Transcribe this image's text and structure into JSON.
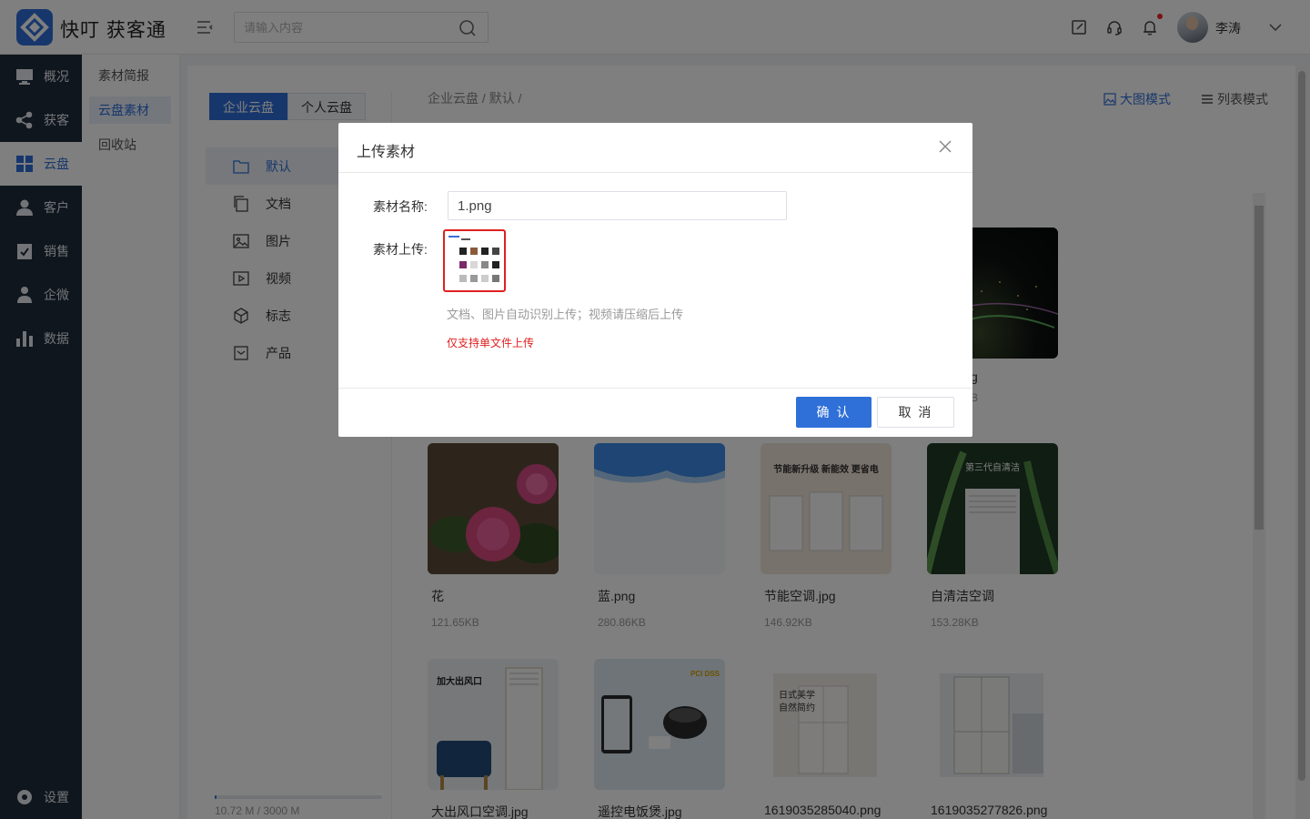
{
  "app": {
    "title": "快叮 获客通"
  },
  "header": {
    "search_placeholder": "请输入内容",
    "user_name": "李涛",
    "icons": [
      "edit-icon",
      "headset-icon",
      "bell-icon",
      "chevron-down-icon"
    ]
  },
  "nav": {
    "items": [
      {
        "label": "概况",
        "icon": "monitor-icon"
      },
      {
        "label": "获客",
        "icon": "share-icon"
      },
      {
        "label": "云盘",
        "icon": "grid-icon"
      },
      {
        "label": "客户",
        "icon": "user-icon"
      },
      {
        "label": "销售",
        "icon": "clipboard-check-icon"
      },
      {
        "label": "企微",
        "icon": "person-icon"
      },
      {
        "label": "数据",
        "icon": "bar-chart-icon"
      }
    ],
    "settings_label": "设置",
    "active": "云盘"
  },
  "subnav": {
    "items": [
      "素材简报",
      "云盘素材",
      "回收站"
    ],
    "active": "云盘素材"
  },
  "disk": {
    "tabs": [
      "企业云盘",
      "个人云盘"
    ],
    "active_tab": "企业云盘",
    "folders": [
      {
        "label": "默认",
        "icon": "folder-icon"
      },
      {
        "label": "文档",
        "icon": "copy-icon"
      },
      {
        "label": "图片",
        "icon": "image-icon"
      },
      {
        "label": "视频",
        "icon": "video-icon"
      },
      {
        "label": "标志",
        "icon": "cube-icon"
      },
      {
        "label": "产品",
        "icon": "box-icon"
      }
    ],
    "active_folder": "默认",
    "storage_text": "10.72 M / 3000 M",
    "storage_fraction": 0.0036
  },
  "content": {
    "breadcrumb": "企业云盘 / 默认 /",
    "view_modes": [
      "大图模式",
      "列表模式"
    ],
    "active_mode": "大图模式",
    "partial_name_tail": "g",
    "partial_size_tail": "B",
    "files": [
      {
        "name": "花",
        "size": "121.65KB"
      },
      {
        "name": "蓝.png",
        "size": "280.86KB"
      },
      {
        "name": "节能空调.jpg",
        "size": "146.92KB",
        "thumb_text": "节能新升级 新能效 更省电"
      },
      {
        "name": "自清洁空调",
        "size": "153.28KB",
        "thumb_text": "第三代自清洁"
      },
      {
        "name": "大出风口空调.jpg",
        "size": "",
        "thumb_text": "加大出风口"
      },
      {
        "name": "遥控电饭煲.jpg",
        "size": "",
        "thumb_text": "PCI DSS"
      },
      {
        "name": "1619035285040.png",
        "size": "",
        "thumb_text": "日式美学 自然简约"
      },
      {
        "name": "1619035277826.png",
        "size": ""
      }
    ]
  },
  "modal": {
    "title": "上传素材",
    "name_label": "素材名称:",
    "name_value": "1.png",
    "upload_label": "素材上传:",
    "hint": "文档、图片自动识别上传；视频请压缩后上传",
    "warning": "仅支持单文件上传",
    "ok_label": "确 认",
    "cancel_label": "取 消"
  },
  "colors": {
    "accent": "#2f6fd8",
    "nav_bg": "#1f2d3d",
    "warning": "#e02020"
  }
}
